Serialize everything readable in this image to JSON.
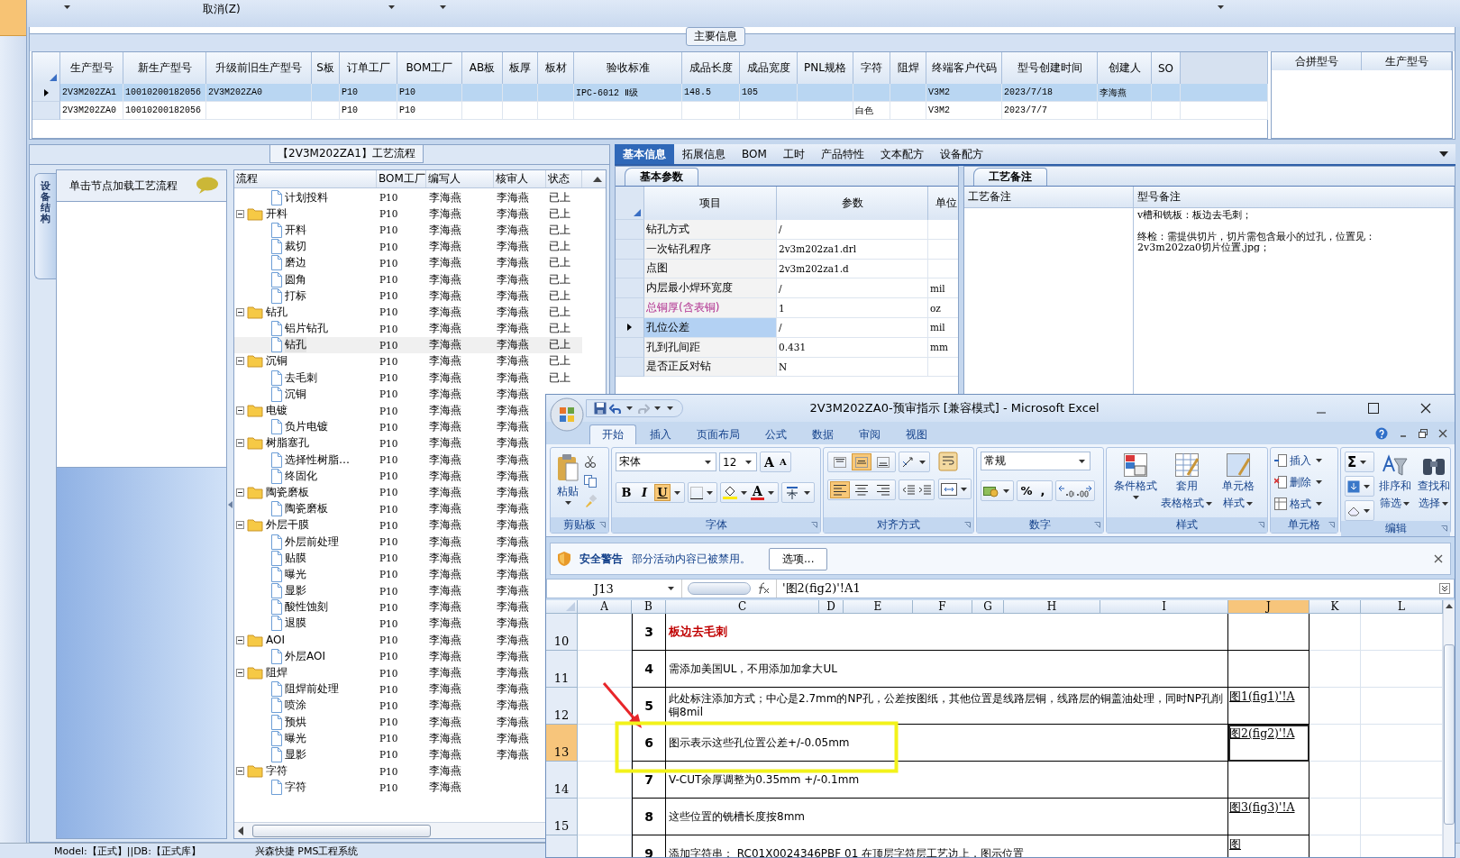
{
  "toolbar": {
    "cancel": "取消(Z)"
  },
  "main_info": {
    "title": "主要信息",
    "columns": [
      "生产型号",
      "新生产型号",
      "升级前旧生产型号",
      "S板",
      "订单工厂",
      "BOM工厂",
      "AB板",
      "板厚",
      "板材",
      "验收标准",
      "成品长度",
      "成品宽度",
      "PNL规格",
      "字符",
      "阻焊",
      "终端客户代码",
      "型号创建时间",
      "创建人",
      "SO"
    ],
    "rows": [
      {
        "selected": true,
        "cells": [
          "2V3M202ZA1",
          "10010200182056",
          "2V3M202ZA0",
          null,
          "P10",
          "P10",
          null,
          null,
          null,
          "IPC-6012 Ⅱ级",
          "148.5",
          "105",
          null,
          null,
          null,
          "V3M2",
          "2023/7/18",
          "李海燕",
          null
        ]
      },
      {
        "selected": false,
        "cells": [
          "2V3M202ZA0",
          "10010200182056",
          null,
          null,
          "P10",
          "P10",
          null,
          null,
          null,
          null,
          null,
          null,
          null,
          "白色",
          null,
          "V3M2",
          "2023/7/7",
          null,
          null
        ]
      }
    ],
    "merge_columns": [
      "合拼型号",
      "生产型号"
    ]
  },
  "process": {
    "title": "【2V3M202ZA1】工艺流程",
    "side_tab": "设备结构",
    "hint": "单击节点加载工艺流程",
    "columns": [
      "流程",
      "BOM工厂",
      "编写人",
      "核审人",
      "状态"
    ],
    "tree": [
      {
        "kind": "step",
        "name": "计划投料",
        "bom": "P10",
        "writer": "李海燕",
        "reviewer": "李海燕",
        "status": "已上",
        "selected": false
      },
      {
        "kind": "folder",
        "name": "开料",
        "bom": "P10",
        "writer": "李海燕",
        "reviewer": "李海燕",
        "status": "已上",
        "selected": false,
        "expanded": true,
        "children": [
          {
            "kind": "step",
            "name": "开料",
            "bom": "P10",
            "writer": "李海燕",
            "reviewer": "李海燕",
            "status": "已上",
            "selected": false
          },
          {
            "kind": "step",
            "name": "裁切",
            "bom": "P10",
            "writer": "李海燕",
            "reviewer": "李海燕",
            "status": "已上",
            "selected": false
          },
          {
            "kind": "step",
            "name": "磨边",
            "bom": "P10",
            "writer": "李海燕",
            "reviewer": "李海燕",
            "status": "已上",
            "selected": false
          },
          {
            "kind": "step",
            "name": "圆角",
            "bom": "P10",
            "writer": "李海燕",
            "reviewer": "李海燕",
            "status": "已上",
            "selected": false
          },
          {
            "kind": "step",
            "name": "打标",
            "bom": "P10",
            "writer": "李海燕",
            "reviewer": "李海燕",
            "status": "已上",
            "selected": false
          }
        ]
      },
      {
        "kind": "folder",
        "name": "钻孔",
        "bom": "P10",
        "writer": "李海燕",
        "reviewer": "李海燕",
        "status": "已上",
        "selected": false,
        "expanded": true,
        "children": [
          {
            "kind": "step",
            "name": "铝片钻孔",
            "bom": "P10",
            "writer": "李海燕",
            "reviewer": "李海燕",
            "status": "已上",
            "selected": false
          },
          {
            "kind": "step",
            "name": "钻孔",
            "bom": "P10",
            "writer": "李海燕",
            "reviewer": "李海燕",
            "status": "已上",
            "selected": true
          }
        ]
      },
      {
        "kind": "folder",
        "name": "沉铜",
        "bom": "P10",
        "writer": "李海燕",
        "reviewer": "李海燕",
        "status": "已上",
        "selected": false,
        "expanded": true,
        "children": [
          {
            "kind": "step",
            "name": "去毛刺",
            "bom": "P10",
            "writer": "李海燕",
            "reviewer": "李海燕",
            "status": "已上",
            "selected": false
          },
          {
            "kind": "step",
            "name": "沉铜",
            "bom": "P10",
            "writer": "李海燕",
            "reviewer": "李海燕",
            "selected": false
          }
        ]
      },
      {
        "kind": "folder",
        "name": "电镀",
        "bom": "P10",
        "writer": "李海燕",
        "reviewer": "李海燕",
        "selected": false,
        "expanded": true,
        "children": [
          {
            "kind": "step",
            "name": "负片电镀",
            "bom": "P10",
            "writer": "李海燕",
            "reviewer": "李海燕",
            "selected": false
          }
        ]
      },
      {
        "kind": "folder",
        "name": "树脂塞孔",
        "bom": "P10",
        "writer": "李海燕",
        "reviewer": "李海燕",
        "selected": false,
        "expanded": true,
        "children": [
          {
            "kind": "step",
            "name": "选择性树脂…",
            "bom": "P10",
            "writer": "李海燕",
            "reviewer": "李海燕",
            "selected": false
          },
          {
            "kind": "step",
            "name": "终固化",
            "bom": "P10",
            "writer": "李海燕",
            "reviewer": "李海燕",
            "selected": false
          }
        ]
      },
      {
        "kind": "folder",
        "name": "陶瓷磨板",
        "bom": "P10",
        "writer": "李海燕",
        "reviewer": "李海燕",
        "selected": false,
        "expanded": true,
        "children": [
          {
            "kind": "step",
            "name": "陶瓷磨板",
            "bom": "P10",
            "writer": "李海燕",
            "reviewer": "李海燕",
            "selected": false
          }
        ]
      },
      {
        "kind": "folder",
        "name": "外层干膜",
        "bom": "P10",
        "writer": "李海燕",
        "reviewer": "李海燕",
        "selected": false,
        "expanded": true,
        "children": [
          {
            "kind": "step",
            "name": "外层前处理",
            "bom": "P10",
            "writer": "李海燕",
            "reviewer": "李海燕",
            "selected": false
          },
          {
            "kind": "step",
            "name": "贴膜",
            "bom": "P10",
            "writer": "李海燕",
            "reviewer": "李海燕",
            "selected": false
          },
          {
            "kind": "step",
            "name": "曝光",
            "bom": "P10",
            "writer": "李海燕",
            "reviewer": "李海燕",
            "selected": false
          },
          {
            "kind": "step",
            "name": "显影",
            "bom": "P10",
            "writer": "李海燕",
            "reviewer": "李海燕",
            "selected": false
          },
          {
            "kind": "step",
            "name": "酸性蚀刻",
            "bom": "P10",
            "writer": "李海燕",
            "reviewer": "李海燕",
            "selected": false
          },
          {
            "kind": "step",
            "name": "退膜",
            "bom": "P10",
            "writer": "李海燕",
            "reviewer": "李海燕",
            "selected": false
          }
        ]
      },
      {
        "kind": "folder",
        "name": "AOI",
        "bom": "P10",
        "writer": "李海燕",
        "reviewer": "李海燕",
        "selected": false,
        "expanded": true,
        "children": [
          {
            "kind": "step",
            "name": "外层AOI",
            "bom": "P10",
            "writer": "李海燕",
            "reviewer": "李海燕",
            "selected": false
          }
        ]
      },
      {
        "kind": "folder",
        "name": "阻焊",
        "bom": "P10",
        "writer": "李海燕",
        "reviewer": "李海燕",
        "selected": false,
        "expanded": true,
        "children": [
          {
            "kind": "step",
            "name": "阻焊前处理",
            "bom": "P10",
            "writer": "李海燕",
            "reviewer": "李海燕",
            "selected": false
          },
          {
            "kind": "step",
            "name": "喷涂",
            "bom": "P10",
            "writer": "李海燕",
            "reviewer": "李海燕",
            "selected": false
          },
          {
            "kind": "step",
            "name": "预烘",
            "bom": "P10",
            "writer": "李海燕",
            "reviewer": "李海燕",
            "selected": false
          },
          {
            "kind": "step",
            "name": "曝光",
            "bom": "P10",
            "writer": "李海燕",
            "reviewer": "李海燕",
            "selected": false
          },
          {
            "kind": "step",
            "name": "显影",
            "bom": "P10",
            "writer": "李海燕",
            "reviewer": "李海燕",
            "selected": false
          }
        ]
      },
      {
        "kind": "folder",
        "name": "字符",
        "bom": "P10",
        "writer": "李海燕",
        "selected": false,
        "expanded": true,
        "children": [
          {
            "kind": "step",
            "name": "字符",
            "bom": "P10",
            "writer": "李海燕",
            "selected": false
          }
        ]
      }
    ]
  },
  "detail_tabs": [
    {
      "label": "基本信息",
      "selected": true
    },
    {
      "label": "拓展信息",
      "selected": false
    },
    {
      "label": "BOM",
      "selected": false
    },
    {
      "label": "工时",
      "selected": false
    },
    {
      "label": "产品特性",
      "selected": false
    },
    {
      "label": "文本配方",
      "selected": false
    },
    {
      "label": "设备配方",
      "selected": false
    }
  ],
  "params": {
    "tab": "基本参数",
    "columns": [
      "项目",
      "参数",
      "单位"
    ],
    "rows": [
      {
        "item": "钻孔方式",
        "value": "/",
        "selected": false
      },
      {
        "item": "一次钻孔程序",
        "value": "2v3m202za1.drl",
        "selected": false
      },
      {
        "item": "点图",
        "value": "2v3m202za1.d",
        "selected": false
      },
      {
        "item": "内层最小焊环宽度",
        "value": "/",
        "unit": "mil",
        "selected": false
      },
      {
        "item": "总铜厚(含表铜)",
        "value": "1",
        "unit": "oz",
        "color": "#b0308f",
        "selected": false
      },
      {
        "item": "孔位公差",
        "value": "/",
        "unit": "mil",
        "selected": true
      },
      {
        "item": "孔到孔间距",
        "value": "0.431",
        "unit": "mm",
        "selected": false
      },
      {
        "item": "是否正反对钻",
        "value": "N",
        "selected": false
      }
    ]
  },
  "notes": {
    "tab": "工艺备注",
    "columns": [
      "工艺备注",
      "型号备注"
    ],
    "model_note": [
      "v槽和铣板：板边去毛刺；",
      "终检：需提供切片，切片需包含最小的过孔，位置见：2v3m202za0切片位置.jpg；"
    ]
  },
  "excel": {
    "title": "2V3M202ZA0-预审指示  [兼容模式] - Microsoft Excel",
    "tabs": [
      {
        "label": "开始",
        "selected": true
      },
      {
        "label": "插入",
        "selected": false
      },
      {
        "label": "页面布局",
        "selected": false
      },
      {
        "label": "公式",
        "selected": false
      },
      {
        "label": "数据",
        "selected": false
      },
      {
        "label": "审阅",
        "selected": false
      },
      {
        "label": "视图",
        "selected": false
      }
    ],
    "clipboard": {
      "label": "剪贴板",
      "paste": "粘贴"
    },
    "font": {
      "label": "字体",
      "name": "宋体",
      "size": "12",
      "grow": "A",
      "shrink": "A",
      "color_letter": "A",
      "styles": [
        {
          "text": "B",
          "selected": false
        },
        {
          "text": "I",
          "selected": false
        },
        {
          "text": "U",
          "selected": true
        }
      ]
    },
    "alignment": {
      "label": "对齐方式",
      "vertical": [
        {
          "selected": false
        },
        {
          "selected": true
        },
        {
          "selected": false
        }
      ],
      "horizontal": [
        {
          "selected": true
        },
        {
          "selected": false
        },
        {
          "selected": false
        }
      ]
    },
    "number": {
      "label": "数字",
      "format": "常规",
      "symbols": [
        "%",
        ","
      ]
    },
    "styles": {
      "label": "样式",
      "buttons": [
        [
          "条件格式"
        ],
        [
          "套用",
          "表格格式"
        ],
        [
          "单元格",
          "样式"
        ]
      ]
    },
    "cells": {
      "label": "单元格",
      "buttons": [
        "插入",
        "删除",
        "格式"
      ]
    },
    "editing": {
      "label": "编辑",
      "sum": "Σ",
      "buttons": [
        [
          "排序和",
          "筛选"
        ],
        [
          "查找和",
          "选择"
        ]
      ]
    },
    "security": {
      "title": "安全警告",
      "message": "部分活动内容已被禁用。",
      "button": "选项..."
    },
    "name_box": "J13",
    "formula": "'图2(fig2)'!A1",
    "columns": [
      {
        "label": "A",
        "selected": false
      },
      {
        "label": "B",
        "selected": false
      },
      {
        "label": "C",
        "selected": false
      },
      {
        "label": "D",
        "selected": false
      },
      {
        "label": "E",
        "selected": false
      },
      {
        "label": "F",
        "selected": false
      },
      {
        "label": "G",
        "selected": false
      },
      {
        "label": "H",
        "selected": false
      },
      {
        "label": "I",
        "selected": false
      },
      {
        "label": "J",
        "selected": true
      },
      {
        "label": "K",
        "selected": false
      },
      {
        "label": "L",
        "selected": false
      }
    ],
    "rows": [
      {
        "header": "10",
        "selected": false,
        "no": "3",
        "text": "板边去毛刺",
        "color": "#c00000"
      },
      {
        "header": "11",
        "selected": false,
        "no": "4",
        "text": "需添加美国UL，不用添加加拿大UL"
      },
      {
        "header": "12",
        "selected": false,
        "no": "5",
        "text": "此处标注添加方式；中心是2.7mm的NP孔，公差按图纸，其他位置是线路层铜，线路层的铜盖油处理，同时NP孔削铜8mil",
        "link": "图1(fig1)'!A"
      },
      {
        "header": "13",
        "selected": true,
        "no": "6",
        "text": "图示表示这些孔位置公差+/-0.05mm",
        "link": "图2(fig2)'!A"
      },
      {
        "header": "14",
        "selected": false,
        "no": "7",
        "text": "V-CUT余厚调整为0.35mm +/-0.1mm"
      },
      {
        "header": "15",
        "selected": false,
        "no": "8",
        "text": "这些位置的铣槽长度按8mm",
        "link": "图3(fig3)'!A"
      },
      {
        "selected": false,
        "no": "9",
        "text": "添加字符串：    RC01X0024346PBF 01    在顶层字符层工艺边上，图示位置",
        "link": "图"
      }
    ]
  },
  "status_bar": {
    "model": "Model:【正式】||DB:【正式库】",
    "system": "兴森快捷 PMS工程系统"
  }
}
